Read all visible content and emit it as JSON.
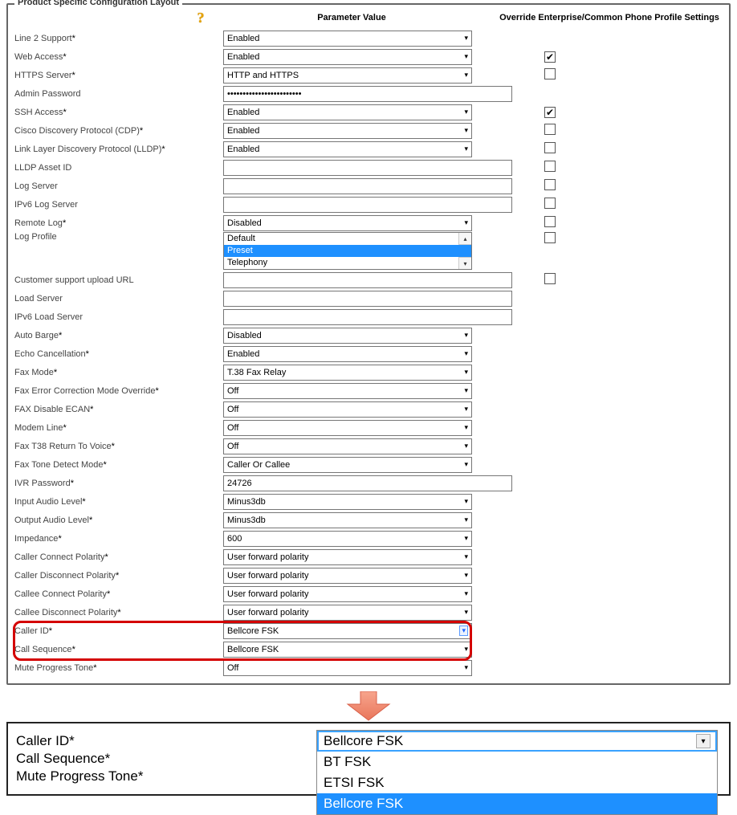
{
  "section_title": "Product Specific Configuration Layout",
  "headers": {
    "param_value": "Parameter Value",
    "override": "Override Enterprise/Common Phone Profile Settings"
  },
  "rows": [
    {
      "label": "Line 2 Support",
      "req": true,
      "type": "select",
      "value": "Enabled"
    },
    {
      "label": "Web Access",
      "req": true,
      "type": "select",
      "value": "Enabled",
      "override": true,
      "override_checked": true
    },
    {
      "label": "HTTPS Server",
      "req": true,
      "type": "select",
      "value": "HTTP and HTTPS",
      "override": true,
      "override_checked": false
    },
    {
      "label": "Admin Password",
      "req": false,
      "type": "password",
      "value": "••••••••••••••••••••••••"
    },
    {
      "label": "SSH Access",
      "req": true,
      "type": "select",
      "value": "Enabled",
      "override": true,
      "override_checked": true
    },
    {
      "label": "Cisco Discovery Protocol (CDP)",
      "req": true,
      "type": "select",
      "value": "Enabled",
      "override": true,
      "override_checked": false
    },
    {
      "label": "Link Layer Discovery Protocol (LLDP)",
      "req": true,
      "type": "select",
      "value": "Enabled",
      "override": true,
      "override_checked": false
    },
    {
      "label": "LLDP Asset ID",
      "req": false,
      "type": "text",
      "value": "",
      "override": true,
      "override_checked": false
    },
    {
      "label": "Log Server",
      "req": false,
      "type": "text",
      "value": "",
      "override": true,
      "override_checked": false
    },
    {
      "label": "IPv6 Log Server",
      "req": false,
      "type": "text",
      "value": "",
      "override": true,
      "override_checked": false
    },
    {
      "label": "Remote Log",
      "req": true,
      "type": "select",
      "value": "Disabled",
      "override": true,
      "override_checked": false
    },
    {
      "label": "Log Profile",
      "req": false,
      "type": "list",
      "options": [
        "Default",
        "Preset",
        "Telephony"
      ],
      "selected_index": 1,
      "override": true,
      "override_checked": false
    },
    {
      "label": "Customer support upload URL",
      "req": false,
      "type": "text",
      "value": "",
      "override": true,
      "override_checked": false
    },
    {
      "label": "Load Server",
      "req": false,
      "type": "text",
      "value": ""
    },
    {
      "label": "IPv6 Load Server",
      "req": false,
      "type": "text",
      "value": ""
    },
    {
      "label": "Auto Barge",
      "req": true,
      "type": "select",
      "value": "Disabled"
    },
    {
      "label": "Echo Cancellation",
      "req": true,
      "type": "select",
      "value": "Enabled"
    },
    {
      "label": "Fax Mode",
      "req": true,
      "type": "select",
      "value": "T.38 Fax Relay"
    },
    {
      "label": "Fax Error Correction Mode Override",
      "req": true,
      "type": "select",
      "value": "Off"
    },
    {
      "label": "FAX Disable ECAN",
      "req": true,
      "type": "select",
      "value": "Off"
    },
    {
      "label": "Modem Line",
      "req": true,
      "type": "select",
      "value": "Off"
    },
    {
      "label": "Fax T38 Return To Voice",
      "req": true,
      "type": "select",
      "value": "Off"
    },
    {
      "label": "Fax Tone Detect Mode",
      "req": true,
      "type": "select",
      "value": "Caller Or Callee"
    },
    {
      "label": "IVR Password",
      "req": true,
      "type": "text",
      "value": "24726"
    },
    {
      "label": "Input Audio Level",
      "req": true,
      "type": "select",
      "value": "Minus3db"
    },
    {
      "label": "Output Audio Level",
      "req": true,
      "type": "select",
      "value": "Minus3db"
    },
    {
      "label": "Impedance",
      "req": true,
      "type": "select",
      "value": "600"
    },
    {
      "label": "Caller Connect Polarity",
      "req": true,
      "type": "select",
      "value": "User forward polarity"
    },
    {
      "label": "Caller Disconnect Polarity",
      "req": true,
      "type": "select",
      "value": "User forward polarity"
    },
    {
      "label": "Callee Connect Polarity",
      "req": true,
      "type": "select",
      "value": "User forward polarity"
    },
    {
      "label": "Callee Disconnect Polarity",
      "req": true,
      "type": "select",
      "value": "User forward polarity"
    },
    {
      "label": "Caller ID",
      "req": true,
      "type": "select",
      "value": "Bellcore FSK",
      "highlight": true,
      "blue_caret": true
    },
    {
      "label": "Call Sequence",
      "req": true,
      "type": "select",
      "value": "Bellcore FSK",
      "highlight": true
    },
    {
      "label": "Mute Progress Tone",
      "req": true,
      "type": "select",
      "value": "Off"
    }
  ],
  "detail": {
    "rows": [
      {
        "label": "Caller ID",
        "req": true
      },
      {
        "label": "Call Sequence",
        "req": true
      },
      {
        "label": "Mute Progress Tone",
        "req": true
      }
    ],
    "select_value": "Bellcore FSK",
    "options": [
      "BT FSK",
      "ETSI FSK",
      "Bellcore FSK"
    ],
    "selected_index": 2
  }
}
